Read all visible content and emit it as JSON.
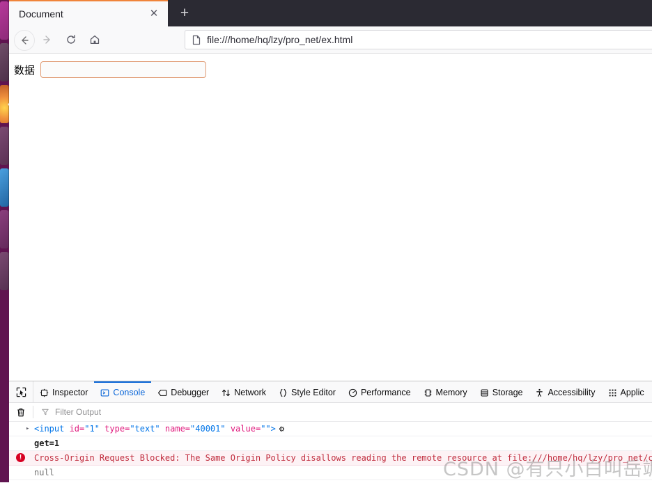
{
  "dock": {
    "name": "ubuntu-launcher",
    "background": "#601450",
    "items": [
      {
        "name": "files-app",
        "color_top": "#b7399b",
        "color_bottom": "#8d2a78",
        "active": false
      },
      {
        "name": "terminal-app",
        "color_top": "#6f4d68",
        "color_bottom": "#4d2f48",
        "active": false
      },
      {
        "name": "firefox-app",
        "color_top": "#f0913c",
        "color_bottom": "#c25f28",
        "active": true
      },
      {
        "name": "text-editor-app",
        "color_top": "#7b4a72",
        "color_bottom": "#5a3053",
        "active": false
      },
      {
        "name": "code-editor-app",
        "color_top": "#3c8fd0",
        "color_bottom": "#2264a0",
        "active": false
      },
      {
        "name": "media-app",
        "color_top": "#8a3f7d",
        "color_bottom": "#63285a",
        "active": false
      },
      {
        "name": "settings-app",
        "color_top": "#7a4a71",
        "color_bottom": "#553050",
        "active": false
      }
    ]
  },
  "browser": {
    "tab": {
      "title": "Document",
      "close_label": "✕",
      "accent_color": "#f0843a"
    },
    "new_tab_label": "+",
    "nav": {
      "back_icon": "back-arrow-icon",
      "forward_icon": "forward-arrow-icon",
      "reload_icon": "reload-icon",
      "home_icon": "home-icon"
    },
    "urlbar": {
      "page_icon": "page-document-icon",
      "url": "file:///home/hq/lzy/pro_net/ex.html"
    }
  },
  "page": {
    "label": "数据",
    "input_value": "",
    "input_placeholder": "",
    "input_border_color": "#e09a72"
  },
  "devtools": {
    "picker_icon": "element-picker-icon",
    "tabs": [
      {
        "label": "Inspector",
        "icon": "inspector-icon",
        "active": false
      },
      {
        "label": "Console",
        "icon": "console-icon",
        "active": true
      },
      {
        "label": "Debugger",
        "icon": "debugger-icon",
        "active": false
      },
      {
        "label": "Network",
        "icon": "network-icon",
        "active": false
      },
      {
        "label": "Style Editor",
        "icon": "style-editor-icon",
        "active": false
      },
      {
        "label": "Performance",
        "icon": "performance-icon",
        "active": false
      },
      {
        "label": "Memory",
        "icon": "memory-icon",
        "active": false
      },
      {
        "label": "Storage",
        "icon": "storage-icon",
        "active": false
      },
      {
        "label": "Accessibility",
        "icon": "accessibility-icon",
        "active": false
      },
      {
        "label": "Applic",
        "icon": "application-icon",
        "active": false
      }
    ],
    "active_tab_color": "#0a66d8",
    "filterbar": {
      "trash_icon": "trash-icon",
      "filter_icon": "funnel-icon",
      "filter_placeholder": "Filter Output",
      "filter_value": ""
    },
    "console_rows": [
      {
        "type": "dom-node",
        "twisty": "▸",
        "tag_open": "<input",
        "attrs": [
          {
            "name": " id=",
            "value": "\"1\""
          },
          {
            "name": " type=",
            "value": "\"text\""
          },
          {
            "name": " name=",
            "value": "\"40001\""
          },
          {
            "name": " value=",
            "value": "\"\""
          }
        ],
        "tag_close": ">",
        "gear_icon": "node-gear-icon"
      },
      {
        "type": "log",
        "text": "get=1"
      },
      {
        "type": "error",
        "icon": "error-circle-icon",
        "text": "Cross-Origin Request Blocked: The Same Origin Policy disallows reading the remote resource at file:///home/hq/lzy/pro_net/cgi-bin/web.c"
      },
      {
        "type": "null",
        "text": "null"
      }
    ]
  },
  "watermark": {
    "text": "CSDN @有只小白叫岳飒"
  }
}
